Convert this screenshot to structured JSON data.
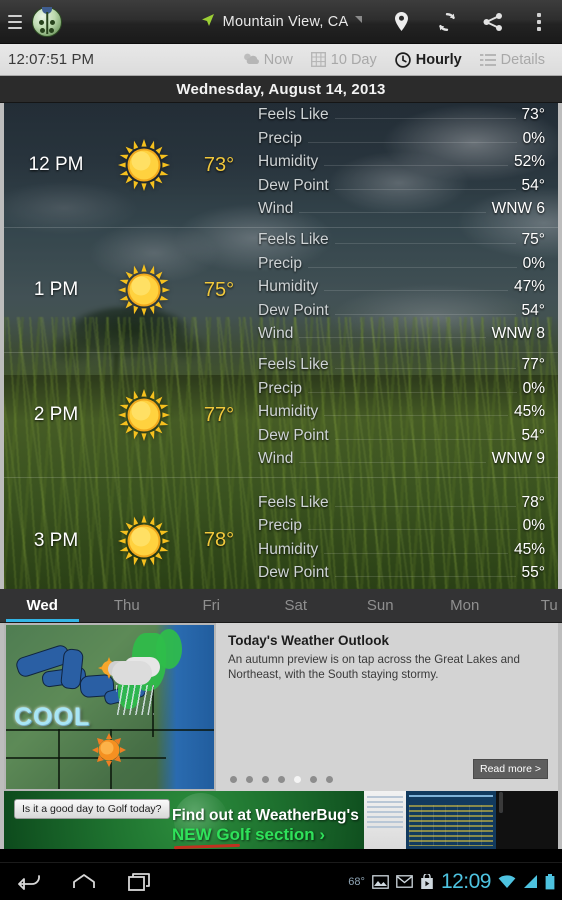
{
  "actionbar": {
    "menu_icon": "hamburger-icon",
    "logo_icon": "weatherbug-ladybug-logo",
    "location": "Mountain View, CA",
    "gps_icon": "gps-arrow-icon",
    "caret_icon": "dropdown-caret-icon",
    "icons": [
      "location-pin-icon",
      "refresh-icon",
      "share-icon",
      "overflow-menu-icon"
    ]
  },
  "tabstrip": {
    "clock": "12:07:51 PM",
    "tabs": [
      {
        "label": "Now",
        "icon": "sun-cloud-icon",
        "active": false
      },
      {
        "label": "10 Day",
        "icon": "grid-icon",
        "active": false
      },
      {
        "label": "Hourly",
        "icon": "clock-icon",
        "active": true
      },
      {
        "label": "Details",
        "icon": "list-icon",
        "active": false
      }
    ]
  },
  "date_header": "Wednesday, August 14, 2013",
  "hourly": {
    "stat_labels": [
      "Feels Like",
      "Precip",
      "Humidity",
      "Dew Point",
      "Wind"
    ],
    "rows": [
      {
        "time": "12 PM",
        "icon": "sunny-icon",
        "temp": "73°",
        "feels_like": "73°",
        "precip": "0%",
        "humidity": "52%",
        "dew_point": "54°",
        "wind": "WNW 6"
      },
      {
        "time": "1 PM",
        "icon": "sunny-icon",
        "temp": "75°",
        "feels_like": "75°",
        "precip": "0%",
        "humidity": "47%",
        "dew_point": "54°",
        "wind": "WNW 8"
      },
      {
        "time": "2 PM",
        "icon": "sunny-icon",
        "temp": "77°",
        "feels_like": "77°",
        "precip": "0%",
        "humidity": "45%",
        "dew_point": "54°",
        "wind": "WNW 9"
      },
      {
        "time": "3 PM",
        "icon": "sunny-icon",
        "temp": "78°",
        "feels_like": "78°",
        "precip": "0%",
        "humidity": "45%",
        "dew_point": "55°",
        "wind": ""
      }
    ]
  },
  "day_tabs": {
    "active_index": 0,
    "accent_color": "#33b5e5",
    "days": [
      "Wed",
      "Thu",
      "Fri",
      "Sat",
      "Sun",
      "Mon",
      "Tu"
    ]
  },
  "outlook": {
    "map_label": "COOL",
    "map_icons": [
      "sun-icon",
      "rain-cloud-icon",
      "sun-icon"
    ],
    "title": "Today's Weather Outlook",
    "body": "An autumn preview is on tap across the Great Lakes and Northeast, with the South staying stormy.",
    "read_more": "Read more >",
    "pager_dots": 7,
    "pager_active": 5
  },
  "ad": {
    "bubble": "Is it a good day to Golf today?",
    "line1": "Find out at WeatherBug's",
    "line2": "NEW Golf section ›"
  },
  "system_bar": {
    "nav": [
      "back-icon",
      "home-icon",
      "recents-icon"
    ],
    "temp": "68°",
    "tray_icons": [
      "image-icon",
      "gmail-icon",
      "play-store-icon",
      "wifi-icon",
      "signal-icon",
      "battery-icon"
    ],
    "clock": "12:09"
  }
}
